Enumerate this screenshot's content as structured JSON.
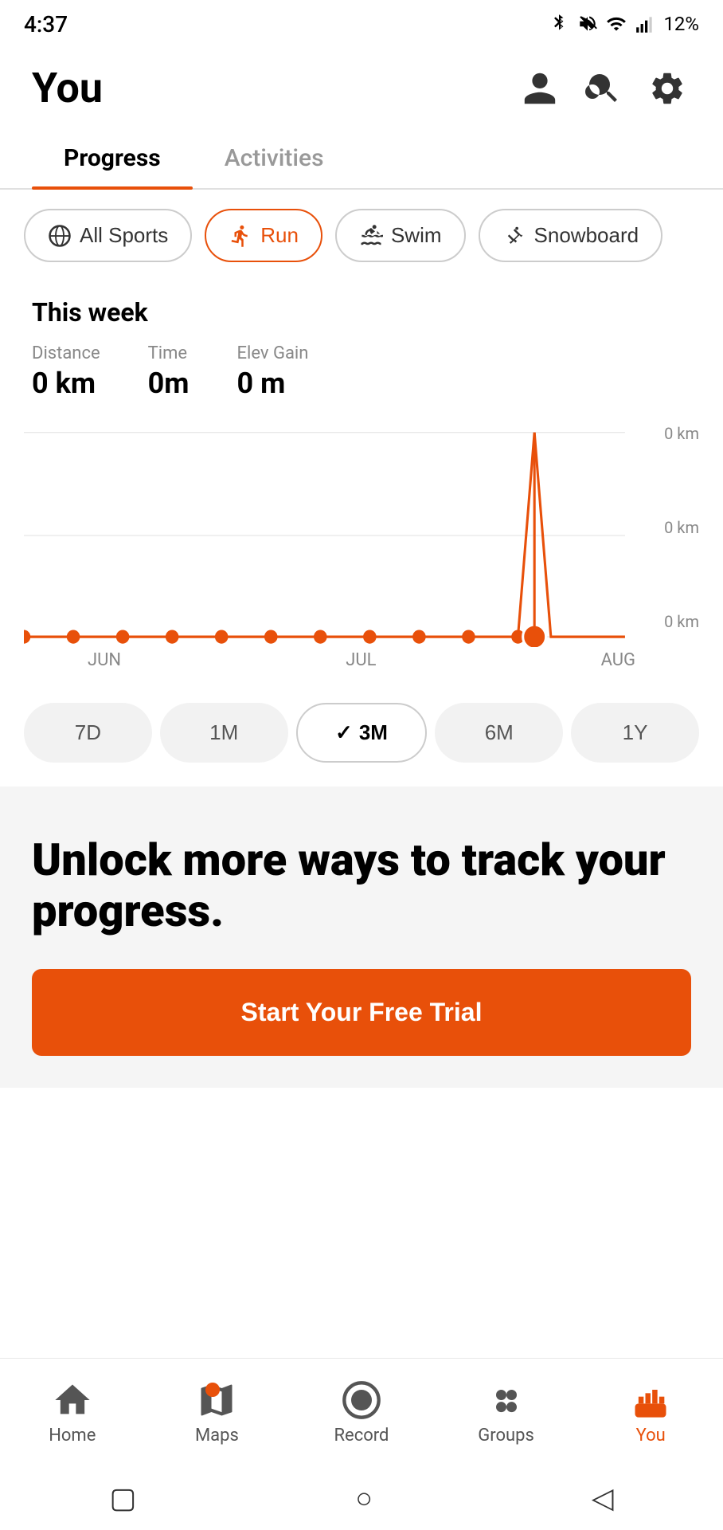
{
  "statusBar": {
    "time": "4:37",
    "battery": "12%",
    "icons": [
      "bluetooth",
      "mute",
      "wifi",
      "signal"
    ]
  },
  "header": {
    "title": "You",
    "profileIcon": "profile-icon",
    "searchIcon": "search-icon",
    "settingsIcon": "settings-icon"
  },
  "tabs": [
    {
      "id": "progress",
      "label": "Progress",
      "active": true
    },
    {
      "id": "activities",
      "label": "Activities",
      "active": false
    }
  ],
  "sportFilters": [
    {
      "id": "all-sports",
      "label": "All Sports",
      "active": false,
      "icon": "all-sports-icon"
    },
    {
      "id": "run",
      "label": "Run",
      "active": true,
      "icon": "run-icon"
    },
    {
      "id": "swim",
      "label": "Swim",
      "active": false,
      "icon": "swim-icon"
    },
    {
      "id": "snowboard",
      "label": "Snowboard",
      "active": false,
      "icon": "snowboard-icon"
    }
  ],
  "thisWeek": {
    "title": "This week",
    "stats": [
      {
        "label": "Distance",
        "value": "0 km"
      },
      {
        "label": "Time",
        "value": "0m"
      },
      {
        "label": "Elev Gain",
        "value": "0 m"
      }
    ]
  },
  "chart": {
    "xLabels": [
      "JUN",
      "JUL",
      "AUG"
    ],
    "yLabels": [
      "0 km",
      "0 km",
      "0 km"
    ]
  },
  "timeRange": {
    "options": [
      {
        "label": "7D",
        "active": false
      },
      {
        "label": "1M",
        "active": false
      },
      {
        "label": "3M",
        "active": true,
        "checkmark": true
      },
      {
        "label": "6M",
        "active": false
      },
      {
        "label": "1Y",
        "active": false
      }
    ]
  },
  "upsell": {
    "title": "Unlock more ways to track your progress.",
    "ctaLabel": "Start Your Free Trial"
  },
  "bottomNav": [
    {
      "id": "home",
      "label": "Home",
      "icon": "home-icon",
      "active": false,
      "badge": false
    },
    {
      "id": "maps",
      "label": "Maps",
      "icon": "maps-icon",
      "active": false,
      "badge": true
    },
    {
      "id": "record",
      "label": "Record",
      "icon": "record-icon",
      "active": false,
      "badge": false
    },
    {
      "id": "groups",
      "label": "Groups",
      "icon": "groups-icon",
      "active": false,
      "badge": false
    },
    {
      "id": "you",
      "label": "You",
      "icon": "you-icon",
      "active": true,
      "badge": false
    }
  ],
  "androidNav": {
    "back": "◁",
    "home": "○",
    "recents": "▢"
  }
}
